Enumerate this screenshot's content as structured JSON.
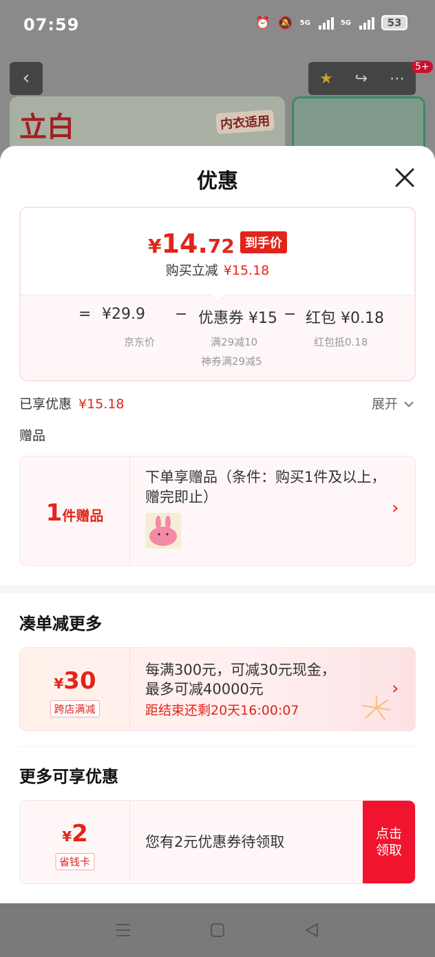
{
  "status": {
    "time": "07:59",
    "battery": "53",
    "net1": "5G",
    "net2": "5G"
  },
  "background": {
    "brand": "立白",
    "tag": "内衣适用",
    "badge": "5+"
  },
  "sheet": {
    "title": "优惠",
    "price": {
      "yen": "¥",
      "int": "14.",
      "dec": "72",
      "badge": "到手价",
      "reduce_label": "购买立减",
      "reduce_value": "¥15.18"
    },
    "formula": {
      "eq": "=",
      "minus1": "−",
      "minus2": "−",
      "jd_price": "¥29.9",
      "jd_price_label": "京东价",
      "coupon": "优惠券 ¥15",
      "coupon_sub1": "满29减10",
      "coupon_sub2": "神券满29减5",
      "redpacket": "红包 ¥0.18",
      "redpacket_sub": "红包抵0.18"
    },
    "enjoyed": {
      "label": "已享优惠",
      "value": "¥15.18",
      "expand": "展开"
    },
    "gift": {
      "section_label": "赠品",
      "count": "1",
      "count_label": "件赠品",
      "desc": "下单享赠品（条件：购买1件及以上，赠完即止）"
    },
    "more": {
      "title": "凑单减更多",
      "amount_yen": "¥",
      "amount": "30",
      "tag": "跨店满减",
      "line1": "每满300元，可减30元现金，",
      "line2": "最多可减40000元",
      "countdown": "距结束还剩20天16:00:07"
    },
    "extra": {
      "title": "更多可享优惠",
      "amount_yen": "¥",
      "amount": "2",
      "tag": "省钱卡",
      "text": "您有2元优惠券待领取",
      "claim1": "点击",
      "claim2": "领取"
    }
  },
  "colors": {
    "accent": "#e1251b",
    "claim": "#f0142e"
  }
}
